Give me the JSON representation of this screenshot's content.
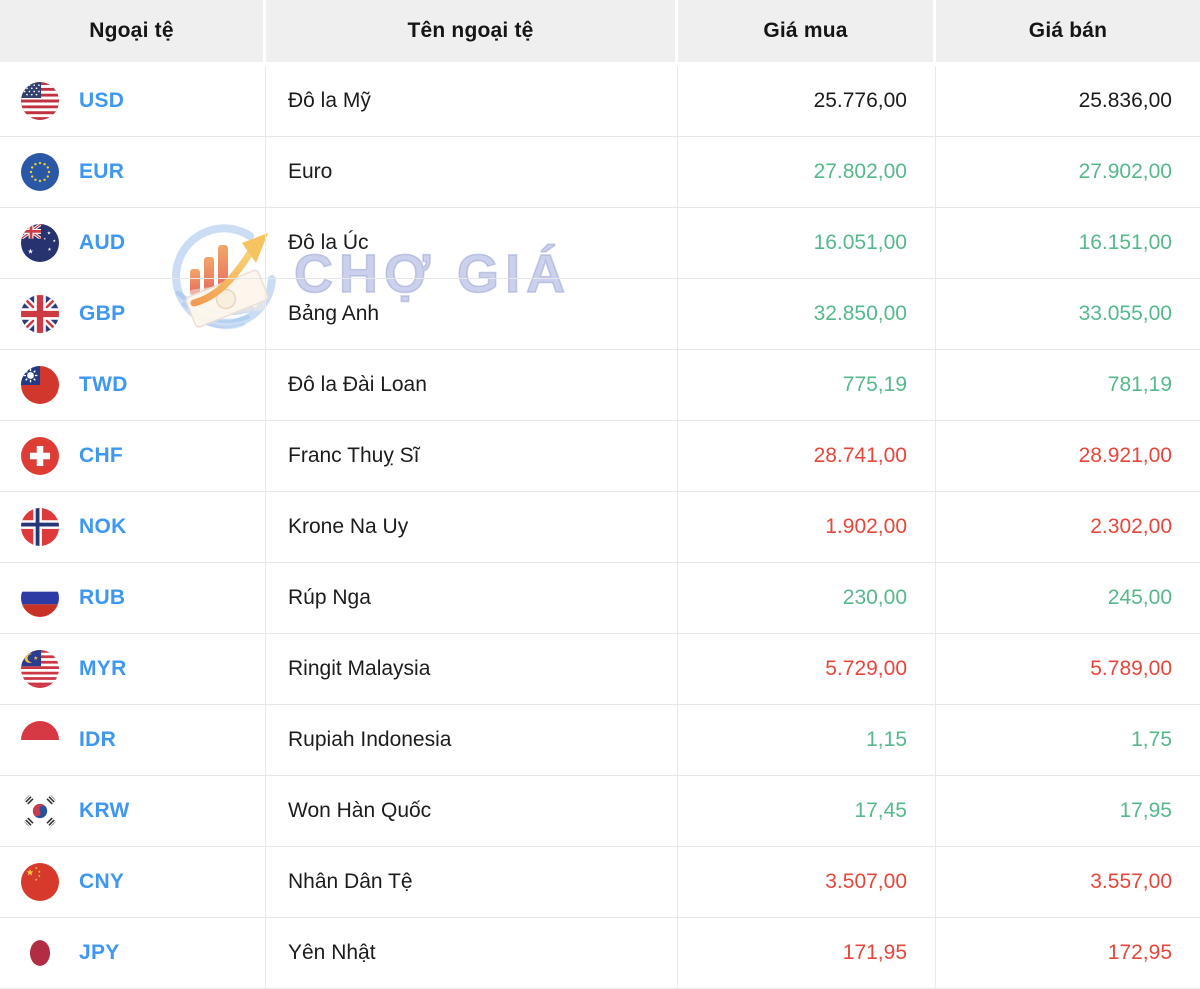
{
  "table": {
    "headers": {
      "currency": "Ngoại tệ",
      "name": "Tên ngoại tệ",
      "buy": "Giá mua",
      "sell": "Giá bán"
    },
    "rows": [
      {
        "code": "USD",
        "name": "Đô la Mỹ",
        "buy": "25.776,00",
        "sell": "25.836,00",
        "trend": "neutral",
        "flag_icon": "usd-flag-icon"
      },
      {
        "code": "EUR",
        "name": "Euro",
        "buy": "27.802,00",
        "sell": "27.902,00",
        "trend": "up",
        "flag_icon": "eur-flag-icon"
      },
      {
        "code": "AUD",
        "name": "Đô la Úc",
        "buy": "16.051,00",
        "sell": "16.151,00",
        "trend": "up",
        "flag_icon": "aud-flag-icon"
      },
      {
        "code": "GBP",
        "name": "Bảng Anh",
        "buy": "32.850,00",
        "sell": "33.055,00",
        "trend": "up",
        "flag_icon": "gbp-flag-icon"
      },
      {
        "code": "TWD",
        "name": "Đô la Đài Loan",
        "buy": "775,19",
        "sell": "781,19",
        "trend": "up",
        "flag_icon": "twd-flag-icon"
      },
      {
        "code": "CHF",
        "name": "Franc Thuỵ Sĩ",
        "buy": "28.741,00",
        "sell": "28.921,00",
        "trend": "down",
        "flag_icon": "chf-flag-icon"
      },
      {
        "code": "NOK",
        "name": "Krone Na Uy",
        "buy": "1.902,00",
        "sell": "2.302,00",
        "trend": "down",
        "flag_icon": "nok-flag-icon"
      },
      {
        "code": "RUB",
        "name": "Rúp Nga",
        "buy": "230,00",
        "sell": "245,00",
        "trend": "up",
        "flag_icon": "rub-flag-icon"
      },
      {
        "code": "MYR",
        "name": "Ringit Malaysia",
        "buy": "5.729,00",
        "sell": "5.789,00",
        "trend": "down",
        "flag_icon": "myr-flag-icon"
      },
      {
        "code": "IDR",
        "name": "Rupiah Indonesia",
        "buy": "1,15",
        "sell": "1,75",
        "trend": "up",
        "flag_icon": "idr-flag-icon"
      },
      {
        "code": "KRW",
        "name": "Won Hàn Quốc",
        "buy": "17,45",
        "sell": "17,95",
        "trend": "up",
        "flag_icon": "krw-flag-icon"
      },
      {
        "code": "CNY",
        "name": "Nhân Dân Tệ",
        "buy": "3.507,00",
        "sell": "3.557,00",
        "trend": "down",
        "flag_icon": "cny-flag-icon"
      },
      {
        "code": "JPY",
        "name": "Yên Nhật",
        "buy": "171,95",
        "sell": "172,95",
        "trend": "down",
        "flag_icon": "jpy-flag-icon"
      }
    ]
  },
  "watermark": {
    "text": "CHỢ GIÁ",
    "logo_icon": "cho-gia-logo-icon"
  },
  "colors": {
    "link_blue": "#3E97F1",
    "up_green": "#55B98A",
    "down_red": "#E5473B",
    "neutral_black": "#1C1C1E",
    "header_bg": "#EFEFEF",
    "separator": "#E7E7E7",
    "watermark_lavender": "#C8CEEB"
  }
}
